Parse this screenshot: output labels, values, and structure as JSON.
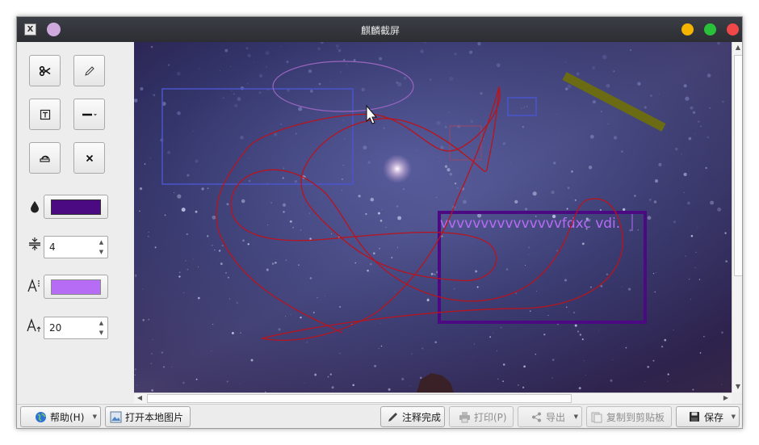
{
  "window": {
    "title": "麒麟截屏",
    "app_icon_glyph": "X"
  },
  "window_buttons": {
    "minimize_color": "#f5b400",
    "maximize_color": "#29c139",
    "close_color": "#f04848",
    "menu_color": "#cfa8de"
  },
  "tools": [
    {
      "name": "cut-tool",
      "icon": "scissors-icon"
    },
    {
      "name": "pencil-tool",
      "icon": "pencil-icon"
    },
    {
      "name": "text-tool",
      "icon": "text-box-icon"
    },
    {
      "name": "line-tool",
      "icon": "line-dropdown-icon"
    },
    {
      "name": "undo-tool",
      "icon": "undo-icon"
    },
    {
      "name": "clear-tool",
      "icon": "close-icon"
    }
  ],
  "properties": {
    "stroke_color": "#4b0a82",
    "stroke_width": "4",
    "font_color": "#b76cf5",
    "font_size": "20"
  },
  "canvas": {
    "annotation_text": "vvvvvvvvvvvvvvvfdxc vdi.",
    "colors": {
      "pen": "#b8141e",
      "blue_shape": "#4a55cc",
      "purple_rect": "#4b0a82",
      "olive_line": "#6b6b14",
      "text": "#b76cf5"
    }
  },
  "bottom_bar": {
    "help_label": "帮助(H)",
    "open_label": "打开本地图片",
    "done_label": "注释完成",
    "print_label": "打印(P)",
    "export_label": "导出",
    "copy_label": "复制到剪贴板",
    "save_label": "保存"
  }
}
